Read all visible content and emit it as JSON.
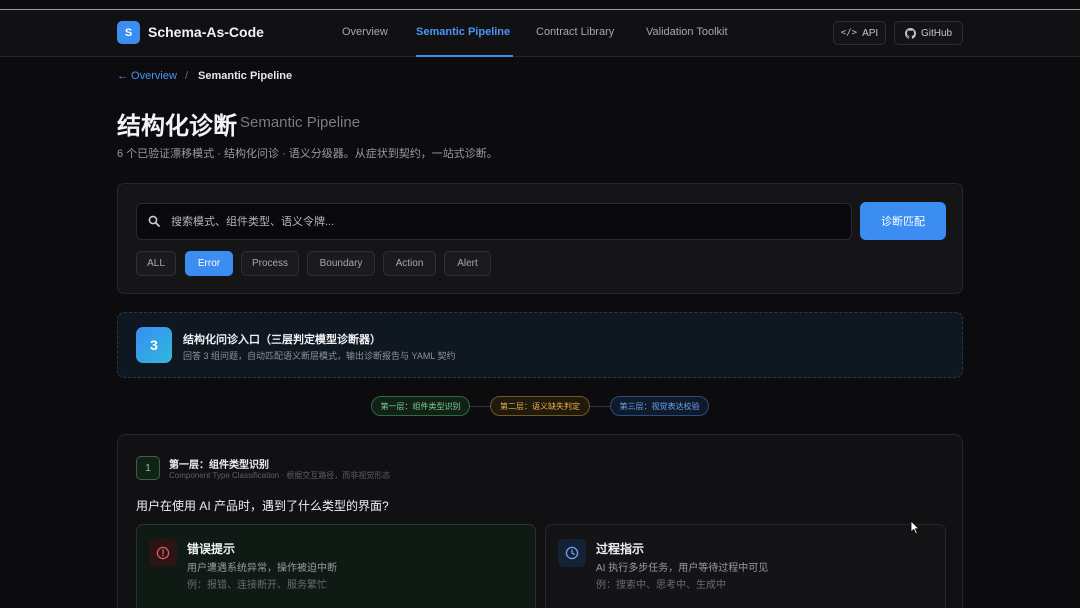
{
  "header": {
    "logo_letter": "S",
    "app_title": "Schema-As-Code",
    "nav": [
      {
        "label": "Overview"
      },
      {
        "label": "Semantic Pipeline"
      },
      {
        "label": "Contract Library"
      },
      {
        "label": "Validation Toolkit"
      }
    ],
    "api_label": "API",
    "github_label": "GitHub"
  },
  "breadcrumb": {
    "back": "← Overview",
    "sep": "/",
    "current": "Semantic Pipeline"
  },
  "page": {
    "title": "结构化诊断",
    "title_en": "Semantic Pipeline",
    "description": "6 个已验证漂移模式 · 结构化问诊 · 语义分级器。从症状到契约，一站式诊断。"
  },
  "search": {
    "placeholder": "搜索模式、组件类型、语义令牌...",
    "value": "",
    "button": "诊断匹配",
    "filters": [
      {
        "label": "ALL"
      },
      {
        "label": "Error"
      },
      {
        "label": "Process"
      },
      {
        "label": "Boundary"
      },
      {
        "label": "Action"
      },
      {
        "label": "Alert"
      }
    ],
    "active_filter": "Error"
  },
  "entry": {
    "number": "3",
    "title": "结构化问诊入口（三层判定模型诊断器）",
    "description": "回答 3 组问题，自动匹配语义断层模式，输出诊断报告与 YAML 契约"
  },
  "pipeline": [
    {
      "label": "第一层：组件类型识别"
    },
    {
      "label": "第二层：语义缺失判定"
    },
    {
      "label": "第三层：视觉表达校验"
    }
  ],
  "layer": {
    "number": "1",
    "title": "第一层：组件类型识别",
    "subtitle": "Component Type Classification · 根据交互路径，而非视觉形态",
    "question": "用户在使用 AI 产品时，遇到了什么类型的界面?",
    "options": [
      {
        "title": "错误提示",
        "description": "用户遭遇系统异常，操作被迫中断",
        "example": "例：报错、连接断开、服务繁忙",
        "icon": "alert-circle-icon"
      },
      {
        "title": "过程指示",
        "description": "AI 执行多步任务，用户等待过程中可见",
        "example": "例：搜索中、思考中、生成中",
        "icon": "clock-icon"
      }
    ]
  },
  "colors": {
    "accent": "#3b8df2",
    "background": "#0c0c0e",
    "layer1": "#7fd28f",
    "layer2": "#e7b34c",
    "layer3": "#6ea5f0",
    "error": "#e05a5a"
  }
}
